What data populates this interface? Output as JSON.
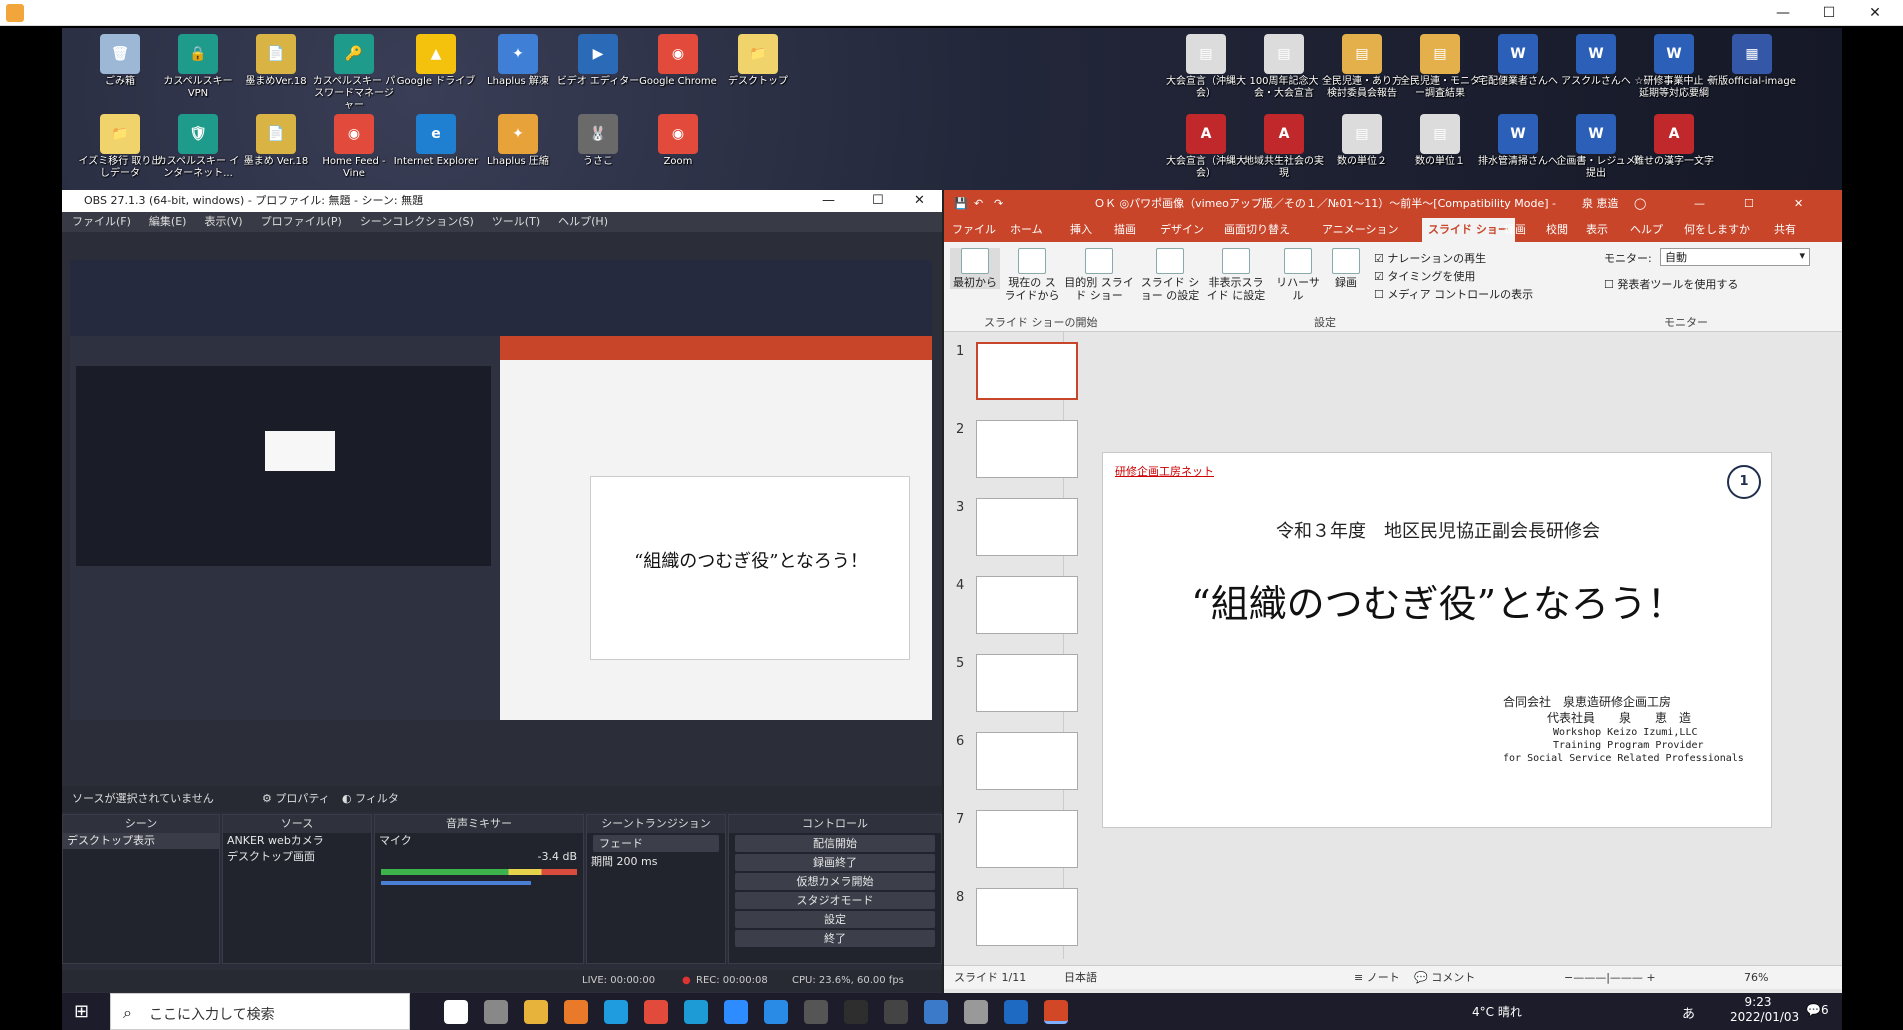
{
  "window": {
    "minimize": "—",
    "maximize": "☐",
    "close": "✕"
  },
  "desktop_icons": [
    {
      "label": "ごみ箱",
      "color": "#9db8d6",
      "icon": "recycle-bin-icon",
      "glyph": "🗑"
    },
    {
      "label": "カスペルスキー VPN",
      "color": "#1e9b8a",
      "icon": "kaspersky-vpn-icon",
      "glyph": "🔒"
    },
    {
      "label": "墨まめVer.18",
      "color": "#d9b343",
      "icon": "document-icon",
      "glyph": "📄"
    },
    {
      "label": "カスペルスキー パスワードマネージャー",
      "color": "#1e9b8a",
      "icon": "key-icon",
      "glyph": "🔑"
    },
    {
      "label": "Google ドライブ",
      "color": "#f4c20d",
      "icon": "google-drive-icon",
      "glyph": "▲"
    },
    {
      "label": "Lhaplus 解凍",
      "color": "#3f7fd6",
      "icon": "lhaplus-icon",
      "glyph": "✦"
    },
    {
      "label": "ビデオ エディター",
      "color": "#2a6ab7",
      "icon": "video-editor-icon",
      "glyph": "▶"
    },
    {
      "label": "Google Chrome",
      "color": "#e24a3b",
      "icon": "chrome-icon",
      "glyph": "◉"
    },
    {
      "label": "デスクトップ",
      "color": "#f1d36b",
      "icon": "folder-icon",
      "glyph": "📁"
    },
    {
      "label": "イズミ移行 取り出しデータ",
      "color": "#f1d36b",
      "icon": "folder-icon",
      "glyph": "📁"
    },
    {
      "label": "カスペルスキー インターネット...",
      "color": "#1e9b8a",
      "icon": "kaspersky-icon",
      "glyph": "🛡"
    },
    {
      "label": "墨まめ Ver.18",
      "color": "#d9b343",
      "icon": "document-icon",
      "glyph": "📄"
    },
    {
      "label": "Home Feed - Vine",
      "color": "#e24a3b",
      "icon": "chrome-icon",
      "glyph": "◉"
    },
    {
      "label": "Internet Explorer",
      "color": "#1f7fd0",
      "icon": "ie-icon",
      "glyph": "e"
    },
    {
      "label": "Lhaplus 圧縮",
      "color": "#e8a23a",
      "icon": "lhaplus-icon",
      "glyph": "✦"
    },
    {
      "label": "うさこ",
      "color": "#6a6a6a",
      "icon": "image-icon",
      "glyph": "🐰"
    },
    {
      "label": "Zoom",
      "color": "#e24a3b",
      "icon": "chrome-icon",
      "glyph": "◉"
    }
  ],
  "desktop_right_icons": [
    {
      "label": "大会宣言（沖縄大会）",
      "color": "#dcdcdc",
      "icon": "document-icon",
      "glyph": "▤"
    },
    {
      "label": "100周年記念大会・大会宣言",
      "color": "#dcdcdc",
      "icon": "document-icon",
      "glyph": "▤"
    },
    {
      "label": "全民児連・あり方検討委員会報告",
      "color": "#e3b04b",
      "icon": "pdf-icon",
      "glyph": "▤"
    },
    {
      "label": "全民児連・モニター調査結果",
      "color": "#e3b04b",
      "icon": "pdf-icon",
      "glyph": "▤"
    },
    {
      "label": "宅配便業者さんへ",
      "color": "#2b5fb8",
      "icon": "word-icon",
      "glyph": "W"
    },
    {
      "label": "アスクルさんへ",
      "color": "#2b5fb8",
      "icon": "word-icon",
      "glyph": "W"
    },
    {
      "label": "☆研修事業中止・延期等対応要綱",
      "color": "#2b5fb8",
      "icon": "word-icon",
      "glyph": "W"
    },
    {
      "label": "新版official-image",
      "color": "#3457a8",
      "icon": "image-icon",
      "glyph": "▦"
    },
    {
      "label": "大会宣言（沖縄大会）",
      "color": "#c0282c",
      "icon": "pdf-icon",
      "glyph": "A"
    },
    {
      "label": "地域共生社会の実現",
      "color": "#c0282c",
      "icon": "pdf-icon",
      "glyph": "A"
    },
    {
      "label": "数の単位２",
      "color": "#dcdcdc",
      "icon": "document-icon",
      "glyph": "▤"
    },
    {
      "label": "数の単位１",
      "color": "#dcdcdc",
      "icon": "document-icon",
      "glyph": "▤"
    },
    {
      "label": "排水管清掃さんへ",
      "color": "#2b5fb8",
      "icon": "word-icon",
      "glyph": "W"
    },
    {
      "label": "企画書・レジュメ提出",
      "color": "#2b5fb8",
      "icon": "word-icon",
      "glyph": "W"
    },
    {
      "label": "難せの漢字一文字",
      "color": "#c0282c",
      "icon": "pdf-icon",
      "glyph": "A"
    }
  ],
  "obs": {
    "title": "OBS 27.1.3 (64-bit, windows) - プロファイル: 無題 - シーン: 無題",
    "menu": [
      "ファイル(F)",
      "編集(E)",
      "表示(V)",
      "プロファイル(P)",
      "シーンコレクション(S)",
      "ツール(T)",
      "ヘルプ(H)"
    ],
    "no_source": "ソースが選択されていません",
    "properties": "プロパティ",
    "filters": "フィルタ",
    "docks": {
      "scenes": {
        "title": "シーン",
        "items": [
          "デスクトップ表示"
        ]
      },
      "sources": {
        "title": "ソース",
        "items": [
          "ANKER webカメラ",
          "デスクトップ画面"
        ]
      },
      "mixer": {
        "title": "音声ミキサー",
        "channel": "マイク",
        "level": "-3.4 dB"
      },
      "transitions": {
        "title": "シーントランジション",
        "type": "フェード",
        "duration_label": "期間",
        "duration": "200 ms"
      },
      "controls": {
        "title": "コントロール",
        "buttons": [
          "配信開始",
          "録画終了",
          "仮想カメラ開始",
          "スタジオモード",
          "設定",
          "終了"
        ]
      }
    },
    "status": {
      "live": "LIVE: 00:00:00",
      "rec": "REC: 00:00:08",
      "cpu": "CPU: 23.6%, 60.00 fps"
    }
  },
  "ppt": {
    "title": "ＯＫ ◎パワポ画像（vimeoアップ版／その１／№01～11）～前半～[Compatibility Mode] -",
    "user": "泉 恵造",
    "tabs": [
      "ファイル",
      "ホーム",
      "挿入",
      "描画",
      "デザイン",
      "画面切り替え",
      "アニメーション",
      "スライド ショー",
      "録画",
      "校閲",
      "表示",
      "ヘルプ",
      "何をしますか",
      "共有"
    ],
    "ribbon": {
      "from_start": "最初から",
      "from_current": "現在の スライドから",
      "custom": "目的別 スライド ショー",
      "setup": "スライド ショー の設定",
      "hide": "非表示スライド に設定",
      "rehearse": "リハーサル",
      "record": "録画",
      "narration": "ナレーションの再生",
      "timing": "タイミングを使用",
      "media": "メディア コントロールの表示",
      "monitor_label": "モニター:",
      "monitor_value": "自動",
      "presenter": "発表者ツールを使用する",
      "group_start": "スライド ショーの開始",
      "group_setup": "設定",
      "group_monitor": "モニター"
    },
    "slide_numbers": [
      "1",
      "2",
      "3",
      "4",
      "5",
      "6",
      "7",
      "8"
    ],
    "slide": {
      "company_link": "研修企画工房ネット",
      "page_number": "1",
      "subtitle": "令和３年度　地区民児協正副会長研修会",
      "title": "“組織のつむぎ役”となろう！",
      "org1": "合同会社　泉恵造研修企画工房",
      "org2": "代表社員　　泉　　恵　造",
      "en1": "Workshop Keizo Izumi,LLC",
      "en2": "Training Program Provider",
      "en3": "for Social Service Related Professionals"
    },
    "status": {
      "slide": "スライド 1/11",
      "lang": "日本語",
      "notes": "ノート",
      "comments": "コメント",
      "zoom": "76%"
    }
  },
  "taskbar": {
    "search_placeholder": "ここに入力して検索",
    "weather": "4°C 晴れ",
    "time": "9:23",
    "date": "2022/01/03",
    "ime": "あ",
    "notifications": "6"
  }
}
